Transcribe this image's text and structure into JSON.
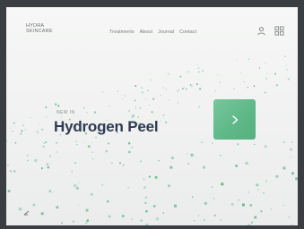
{
  "header": {
    "brand_line1": "HYDRA",
    "brand_line2": "SKINCARE",
    "nav": [
      "Treatments",
      "About",
      "Journal",
      "Contact"
    ],
    "icons": [
      "user-icon",
      "menu-grid-icon"
    ]
  },
  "hero": {
    "eyebrow": "NEW IN",
    "title": "Hydrogen Peel",
    "cta_icon": "chevron-right-icon"
  },
  "colors": {
    "accent": "#5db787",
    "title": "#2d3b52",
    "background": "#f1f2f1",
    "frame": "#3a3d42"
  }
}
